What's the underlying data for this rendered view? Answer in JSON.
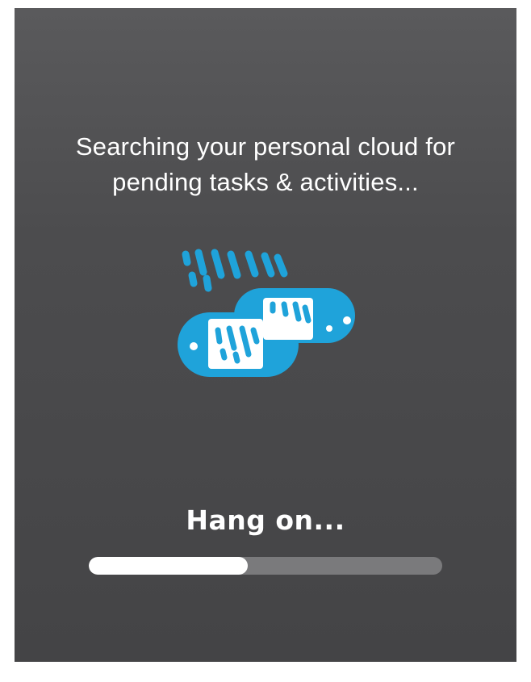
{
  "message": {
    "line1": "Searching your personal cloud for",
    "line2": "pending tasks & activities..."
  },
  "logo": {
    "icon": "cloud-tasks-logo-icon",
    "color": "#1fa3da"
  },
  "status": {
    "label": "Hang on..."
  },
  "progress": {
    "fraction": 0.45,
    "track_color": "#7a7a7c",
    "fill_color": "#ffffff"
  }
}
